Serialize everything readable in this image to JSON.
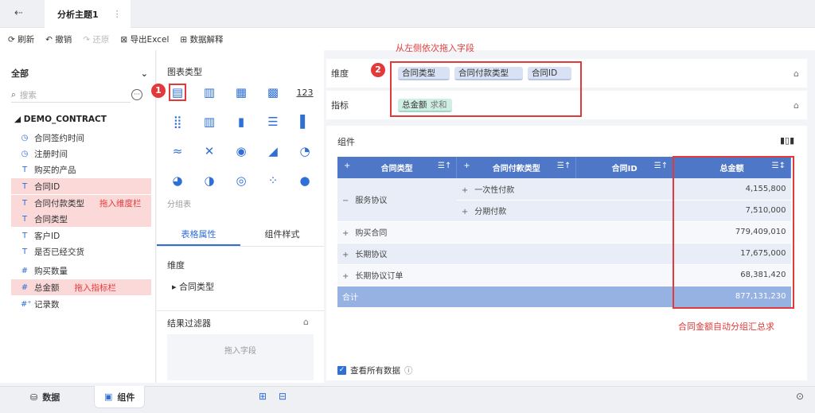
{
  "header": {
    "back_icon": "exit-icon",
    "tab_title": "分析主题1",
    "tab_more": "⋮"
  },
  "toolbar": {
    "refresh": "刷新",
    "undo": "撤销",
    "redo": "还原",
    "export": "导出Excel",
    "explain": "数据解释"
  },
  "annotations": {
    "drag_fields": "从左侧依次拖入字段",
    "drag_dim": "拖入维度栏",
    "drag_measure": "拖入指标栏",
    "auto_sum": "合同金额自动分组汇总求",
    "badge1": "1",
    "badge2": "2"
  },
  "left": {
    "select_value": "全部",
    "search_placeholder": "搜索",
    "dataset": "DEMO_CONTRACT",
    "fields": [
      {
        "icon": "◷",
        "label": "合同签约时间"
      },
      {
        "icon": "◷",
        "label": "注册时间"
      },
      {
        "icon": "T",
        "label": "购买的产品"
      },
      {
        "icon": "T",
        "label": "合同ID"
      },
      {
        "icon": "T",
        "label": "合同付款类型"
      },
      {
        "icon": "T",
        "label": "合同类型"
      },
      {
        "icon": "T",
        "label": "客户ID"
      },
      {
        "icon": "T",
        "label": "是否已经交货"
      },
      {
        "icon": "#",
        "label": "购买数量"
      },
      {
        "icon": "#",
        "label": "总金额"
      },
      {
        "icon": "#⁺",
        "label": "记录数"
      }
    ]
  },
  "middle": {
    "chart_types_title": "图表类型",
    "group_table": "分组表",
    "tab_table_props": "表格属性",
    "tab_component_style": "组件样式",
    "dimension_title": "维度",
    "dimension_item": "合同类型",
    "filter_title": "结果过滤器",
    "filter_placeholder": "拖入字段"
  },
  "drop": {
    "dim_label": "维度",
    "measure_label": "指标",
    "dims": [
      "合同类型",
      "合同付款类型",
      "合同ID"
    ],
    "measure": "总金额",
    "measure_agg": "求和"
  },
  "canvas": {
    "title": "组件",
    "headers": [
      "合同类型",
      "合同付款类型",
      "合同ID",
      "总金额"
    ],
    "rows": [
      {
        "type": "服务协议",
        "pay": "一次性付款",
        "amount": "4,155,800"
      },
      {
        "type": "",
        "pay": "分期付款",
        "amount": "7,510,000"
      },
      {
        "type": "购买合同",
        "pay": "",
        "amount": "779,409,010"
      },
      {
        "type": "长期协议",
        "pay": "",
        "amount": "17,675,000"
      },
      {
        "type": "长期协议订单",
        "pay": "",
        "amount": "68,381,420"
      }
    ],
    "total_label": "合计",
    "total_amount": "877,131,230",
    "show_all": "查看所有数据"
  },
  "bottom": {
    "data_tab": "数据",
    "component_tab": "组件"
  }
}
